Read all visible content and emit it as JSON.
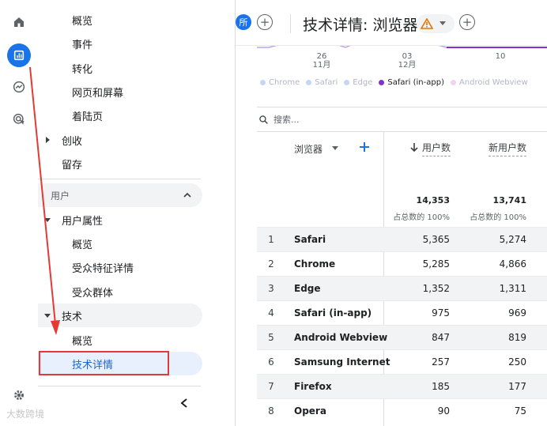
{
  "header": {
    "all_users_chip": "所",
    "title": "技术详情: 浏览器"
  },
  "rail": {
    "icons": [
      "home-icon",
      "reports-icon",
      "explore-icon",
      "advertising-icon",
      "settings-icon"
    ]
  },
  "sidebar": {
    "items": [
      {
        "label": "概览"
      },
      {
        "label": "事件"
      },
      {
        "label": "转化"
      },
      {
        "label": "网页和屏幕"
      },
      {
        "label": "着陆页"
      },
      {
        "label": "创收"
      },
      {
        "label": "留存"
      },
      {
        "label": "用户"
      },
      {
        "label": "用户属性"
      },
      {
        "label": "概览"
      },
      {
        "label": "受众特征详情"
      },
      {
        "label": "受众群体"
      },
      {
        "label": "技术"
      },
      {
        "label": "概览"
      },
      {
        "label": "技术详情"
      }
    ]
  },
  "chart": {
    "x_ticks": [
      {
        "day": "26",
        "month": "11月"
      },
      {
        "day": "03",
        "month": "12月"
      },
      {
        "day": "10",
        "month": ""
      }
    ],
    "legend": [
      {
        "label": "Chrome",
        "color": "#c5d6f5",
        "text_color": "#b0b7c3"
      },
      {
        "label": "Safari",
        "color": "#c5d6f5",
        "text_color": "#b0b7c3"
      },
      {
        "label": "Edge",
        "color": "#c5d6f5",
        "text_color": "#b0b7c3"
      },
      {
        "label": "Safari (in-app)",
        "color": "#8430ce",
        "text_color": "#202124"
      },
      {
        "label": "Android Webview",
        "color": "#efd3ef",
        "text_color": "#b0b7c3"
      }
    ]
  },
  "search": {
    "placeholder": "搜索..."
  },
  "table": {
    "dimension_header": "浏览器",
    "metric1_header": "用户数",
    "metric2_header": "新用户数",
    "total1": "14,353",
    "total2": "13,741",
    "total1_pct": "占总数的 100%",
    "total2_pct": "占总数的 100%",
    "rows": [
      {
        "rank": "1",
        "name": "Safari",
        "users": "5,365",
        "new_users": "5,274"
      },
      {
        "rank": "2",
        "name": "Chrome",
        "users": "5,285",
        "new_users": "4,866"
      },
      {
        "rank": "3",
        "name": "Edge",
        "users": "1,352",
        "new_users": "1,311"
      },
      {
        "rank": "4",
        "name": "Safari (in-app)",
        "users": "975",
        "new_users": "969"
      },
      {
        "rank": "5",
        "name": "Android Webview",
        "users": "847",
        "new_users": "819"
      },
      {
        "rank": "6",
        "name": "Samsung Internet",
        "users": "257",
        "new_users": "250"
      },
      {
        "rank": "7",
        "name": "Firefox",
        "users": "185",
        "new_users": "177"
      },
      {
        "rank": "8",
        "name": "Opera",
        "users": "90",
        "new_users": "75"
      }
    ]
  },
  "watermark": "大数跨境",
  "colors": {
    "accent": "#1a73e8",
    "annotation": "#e53935"
  }
}
